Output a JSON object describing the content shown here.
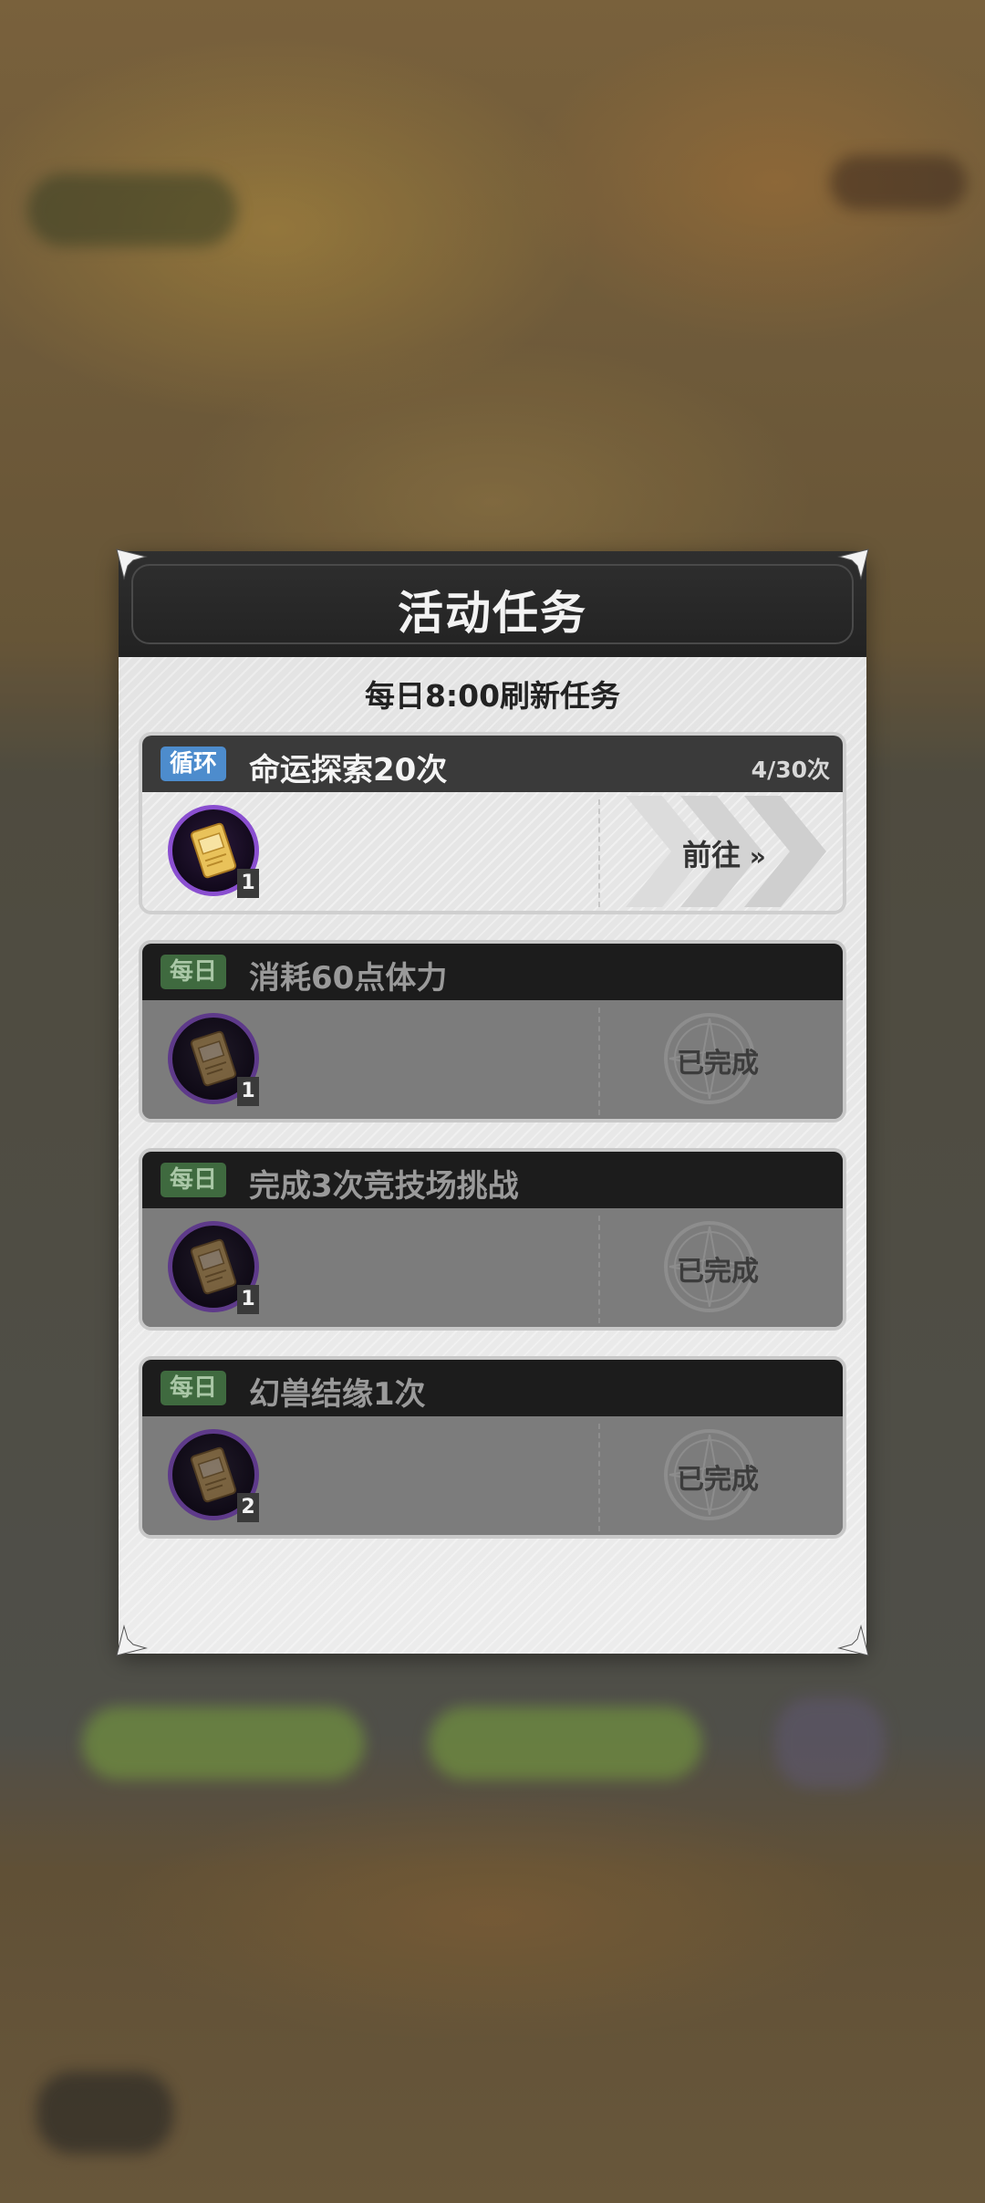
{
  "panel": {
    "title": "活动任务",
    "subtitle": "每日8:00刷新任务"
  },
  "tasks": [
    {
      "tag": "循环",
      "title": "命运探索20次",
      "progress": "4/30次",
      "reward_count": "1",
      "action": "前往",
      "status": "active"
    },
    {
      "tag": "每日",
      "title": "消耗60点体力",
      "reward_count": "1",
      "action": "已完成",
      "status": "done"
    },
    {
      "tag": "每日",
      "title": "完成3次竞技场挑战",
      "reward_count": "1",
      "action": "已完成",
      "status": "done"
    },
    {
      "tag": "每日",
      "title": "幻兽结缘1次",
      "reward_count": "2",
      "action": "已完成",
      "status": "done"
    }
  ],
  "colors": {
    "loop_tag": "#4d8ccd",
    "daily_tag": "#3f6a3f",
    "reward_ring": "#8a4fd0",
    "panel_header": "#262626"
  }
}
